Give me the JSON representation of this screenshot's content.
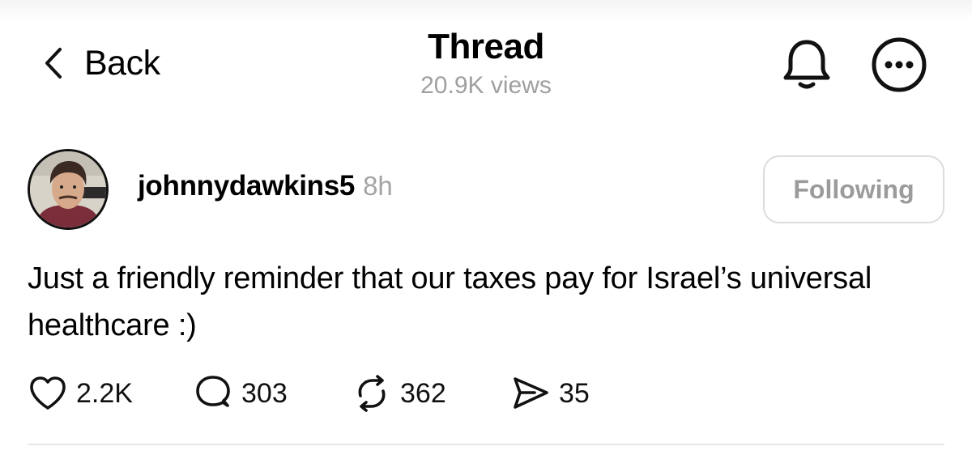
{
  "header": {
    "back_label": "Back",
    "title": "Thread",
    "views": "20.9K views",
    "bell_icon": "bell-icon",
    "more_icon": "more-options-icon"
  },
  "post": {
    "author": {
      "username": "johnnydawkins5",
      "time_ago": "8h",
      "avatar": "profile-photo"
    },
    "follow_button_label": "Following",
    "text": "Just a friendly reminder that our taxes pay for Israel’s universal healthcare :)",
    "actions": {
      "likes": "2.2K",
      "replies": "303",
      "reposts": "362",
      "shares": "35"
    }
  },
  "colors": {
    "text_primary": "#000000",
    "text_secondary": "#a0a0a0",
    "button_border": "#dcdcdc",
    "divider": "#e6e6e6"
  }
}
